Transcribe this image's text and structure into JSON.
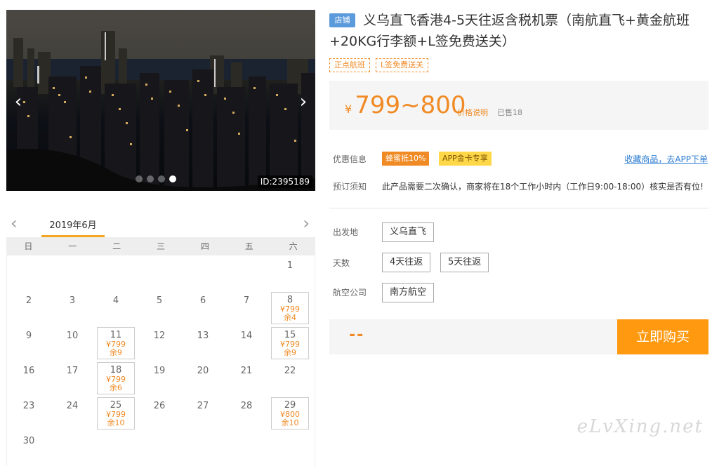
{
  "hero": {
    "image_id": "ID:2395189",
    "prev_icon": "chevron-left-icon",
    "next_icon": "chevron-right-icon",
    "slide_count": 4,
    "active_slide": 4
  },
  "product": {
    "shop_tag": "店铺",
    "title": "义乌直飞香港4-5天往返含税机票（南航直飞+黄金航班+20KG行李额+L签免费送关）",
    "tags": [
      "正点航班",
      "L签免费送关"
    ]
  },
  "price": {
    "currency": "¥",
    "value": "799~800",
    "note": "价格说明",
    "sold": "已售18"
  },
  "promo": {
    "label": "优惠信息",
    "badge1": "蜂蜜抵10%",
    "badge2": "APP金卡专享",
    "fav_link": "收藏商品，去APP下单"
  },
  "booking": {
    "label": "预订须知",
    "text": "此产品需要二次确认，商家将在18个工作小时内（工作日9:00-18:00）核实是否有位!"
  },
  "options": {
    "departure_label": "出发地",
    "departure": "义乌直飞",
    "days_label": "天数",
    "days": [
      "4天往返",
      "5天往返"
    ],
    "airline_label": "航空公司",
    "airline": "南方航空"
  },
  "buy": {
    "price": "--",
    "button": "立即购买"
  },
  "calendar": {
    "month": "2019年6月",
    "weekdays": [
      "日",
      "一",
      "二",
      "三",
      "四",
      "五",
      "六"
    ],
    "cells": [
      {
        "day": ""
      },
      {
        "day": ""
      },
      {
        "day": ""
      },
      {
        "day": ""
      },
      {
        "day": ""
      },
      {
        "day": ""
      },
      {
        "day": "1"
      },
      {
        "day": "2"
      },
      {
        "day": "3"
      },
      {
        "day": "4"
      },
      {
        "day": "5"
      },
      {
        "day": "6"
      },
      {
        "day": "7"
      },
      {
        "day": "8",
        "price": "¥799",
        "remain": "余4"
      },
      {
        "day": "9"
      },
      {
        "day": "10"
      },
      {
        "day": "11",
        "price": "¥799",
        "remain": "余9"
      },
      {
        "day": "12"
      },
      {
        "day": "13"
      },
      {
        "day": "14"
      },
      {
        "day": "15",
        "price": "¥799",
        "remain": "余9"
      },
      {
        "day": "16"
      },
      {
        "day": "17"
      },
      {
        "day": "18",
        "price": "¥799",
        "remain": "余6"
      },
      {
        "day": "19"
      },
      {
        "day": "20"
      },
      {
        "day": "21"
      },
      {
        "day": "22"
      },
      {
        "day": "23"
      },
      {
        "day": "24"
      },
      {
        "day": "25",
        "price": "¥799",
        "remain": "余10"
      },
      {
        "day": "26"
      },
      {
        "day": "27"
      },
      {
        "day": "28"
      },
      {
        "day": "29",
        "price": "¥800",
        "remain": "余10"
      },
      {
        "day": "30"
      }
    ]
  },
  "watermark": "eLvXing.net",
  "colors": {
    "accent": "#f08a24",
    "buy_button": "#ff9910",
    "shop_tag": "#5b9bdc",
    "link": "#2a7bd1"
  }
}
